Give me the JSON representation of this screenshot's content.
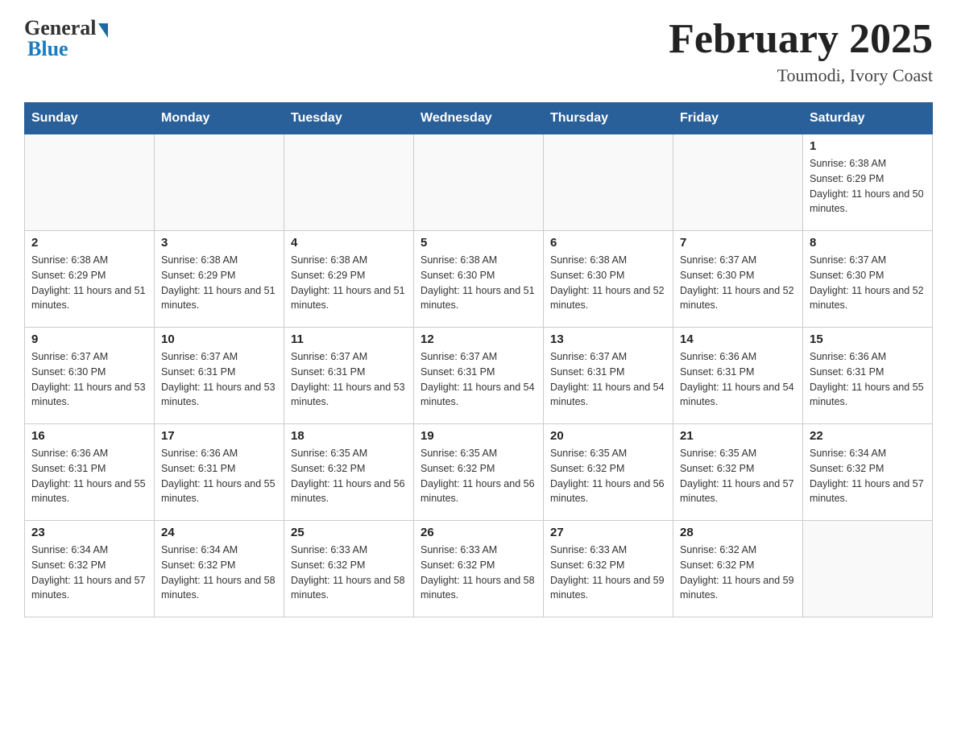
{
  "header": {
    "logo_general": "General",
    "logo_blue": "Blue",
    "title": "February 2025",
    "location": "Toumodi, Ivory Coast"
  },
  "days_of_week": [
    "Sunday",
    "Monday",
    "Tuesday",
    "Wednesday",
    "Thursday",
    "Friday",
    "Saturday"
  ],
  "weeks": [
    [
      {
        "day": "",
        "sunrise": "",
        "sunset": "",
        "daylight": ""
      },
      {
        "day": "",
        "sunrise": "",
        "sunset": "",
        "daylight": ""
      },
      {
        "day": "",
        "sunrise": "",
        "sunset": "",
        "daylight": ""
      },
      {
        "day": "",
        "sunrise": "",
        "sunset": "",
        "daylight": ""
      },
      {
        "day": "",
        "sunrise": "",
        "sunset": "",
        "daylight": ""
      },
      {
        "day": "",
        "sunrise": "",
        "sunset": "",
        "daylight": ""
      },
      {
        "day": "1",
        "sunrise": "Sunrise: 6:38 AM",
        "sunset": "Sunset: 6:29 PM",
        "daylight": "Daylight: 11 hours and 50 minutes."
      }
    ],
    [
      {
        "day": "2",
        "sunrise": "Sunrise: 6:38 AM",
        "sunset": "Sunset: 6:29 PM",
        "daylight": "Daylight: 11 hours and 51 minutes."
      },
      {
        "day": "3",
        "sunrise": "Sunrise: 6:38 AM",
        "sunset": "Sunset: 6:29 PM",
        "daylight": "Daylight: 11 hours and 51 minutes."
      },
      {
        "day": "4",
        "sunrise": "Sunrise: 6:38 AM",
        "sunset": "Sunset: 6:29 PM",
        "daylight": "Daylight: 11 hours and 51 minutes."
      },
      {
        "day": "5",
        "sunrise": "Sunrise: 6:38 AM",
        "sunset": "Sunset: 6:30 PM",
        "daylight": "Daylight: 11 hours and 51 minutes."
      },
      {
        "day": "6",
        "sunrise": "Sunrise: 6:38 AM",
        "sunset": "Sunset: 6:30 PM",
        "daylight": "Daylight: 11 hours and 52 minutes."
      },
      {
        "day": "7",
        "sunrise": "Sunrise: 6:37 AM",
        "sunset": "Sunset: 6:30 PM",
        "daylight": "Daylight: 11 hours and 52 minutes."
      },
      {
        "day": "8",
        "sunrise": "Sunrise: 6:37 AM",
        "sunset": "Sunset: 6:30 PM",
        "daylight": "Daylight: 11 hours and 52 minutes."
      }
    ],
    [
      {
        "day": "9",
        "sunrise": "Sunrise: 6:37 AM",
        "sunset": "Sunset: 6:30 PM",
        "daylight": "Daylight: 11 hours and 53 minutes."
      },
      {
        "day": "10",
        "sunrise": "Sunrise: 6:37 AM",
        "sunset": "Sunset: 6:31 PM",
        "daylight": "Daylight: 11 hours and 53 minutes."
      },
      {
        "day": "11",
        "sunrise": "Sunrise: 6:37 AM",
        "sunset": "Sunset: 6:31 PM",
        "daylight": "Daylight: 11 hours and 53 minutes."
      },
      {
        "day": "12",
        "sunrise": "Sunrise: 6:37 AM",
        "sunset": "Sunset: 6:31 PM",
        "daylight": "Daylight: 11 hours and 54 minutes."
      },
      {
        "day": "13",
        "sunrise": "Sunrise: 6:37 AM",
        "sunset": "Sunset: 6:31 PM",
        "daylight": "Daylight: 11 hours and 54 minutes."
      },
      {
        "day": "14",
        "sunrise": "Sunrise: 6:36 AM",
        "sunset": "Sunset: 6:31 PM",
        "daylight": "Daylight: 11 hours and 54 minutes."
      },
      {
        "day": "15",
        "sunrise": "Sunrise: 6:36 AM",
        "sunset": "Sunset: 6:31 PM",
        "daylight": "Daylight: 11 hours and 55 minutes."
      }
    ],
    [
      {
        "day": "16",
        "sunrise": "Sunrise: 6:36 AM",
        "sunset": "Sunset: 6:31 PM",
        "daylight": "Daylight: 11 hours and 55 minutes."
      },
      {
        "day": "17",
        "sunrise": "Sunrise: 6:36 AM",
        "sunset": "Sunset: 6:31 PM",
        "daylight": "Daylight: 11 hours and 55 minutes."
      },
      {
        "day": "18",
        "sunrise": "Sunrise: 6:35 AM",
        "sunset": "Sunset: 6:32 PM",
        "daylight": "Daylight: 11 hours and 56 minutes."
      },
      {
        "day": "19",
        "sunrise": "Sunrise: 6:35 AM",
        "sunset": "Sunset: 6:32 PM",
        "daylight": "Daylight: 11 hours and 56 minutes."
      },
      {
        "day": "20",
        "sunrise": "Sunrise: 6:35 AM",
        "sunset": "Sunset: 6:32 PM",
        "daylight": "Daylight: 11 hours and 56 minutes."
      },
      {
        "day": "21",
        "sunrise": "Sunrise: 6:35 AM",
        "sunset": "Sunset: 6:32 PM",
        "daylight": "Daylight: 11 hours and 57 minutes."
      },
      {
        "day": "22",
        "sunrise": "Sunrise: 6:34 AM",
        "sunset": "Sunset: 6:32 PM",
        "daylight": "Daylight: 11 hours and 57 minutes."
      }
    ],
    [
      {
        "day": "23",
        "sunrise": "Sunrise: 6:34 AM",
        "sunset": "Sunset: 6:32 PM",
        "daylight": "Daylight: 11 hours and 57 minutes."
      },
      {
        "day": "24",
        "sunrise": "Sunrise: 6:34 AM",
        "sunset": "Sunset: 6:32 PM",
        "daylight": "Daylight: 11 hours and 58 minutes."
      },
      {
        "day": "25",
        "sunrise": "Sunrise: 6:33 AM",
        "sunset": "Sunset: 6:32 PM",
        "daylight": "Daylight: 11 hours and 58 minutes."
      },
      {
        "day": "26",
        "sunrise": "Sunrise: 6:33 AM",
        "sunset": "Sunset: 6:32 PM",
        "daylight": "Daylight: 11 hours and 58 minutes."
      },
      {
        "day": "27",
        "sunrise": "Sunrise: 6:33 AM",
        "sunset": "Sunset: 6:32 PM",
        "daylight": "Daylight: 11 hours and 59 minutes."
      },
      {
        "day": "28",
        "sunrise": "Sunrise: 6:32 AM",
        "sunset": "Sunset: 6:32 PM",
        "daylight": "Daylight: 11 hours and 59 minutes."
      },
      {
        "day": "",
        "sunrise": "",
        "sunset": "",
        "daylight": ""
      }
    ]
  ]
}
